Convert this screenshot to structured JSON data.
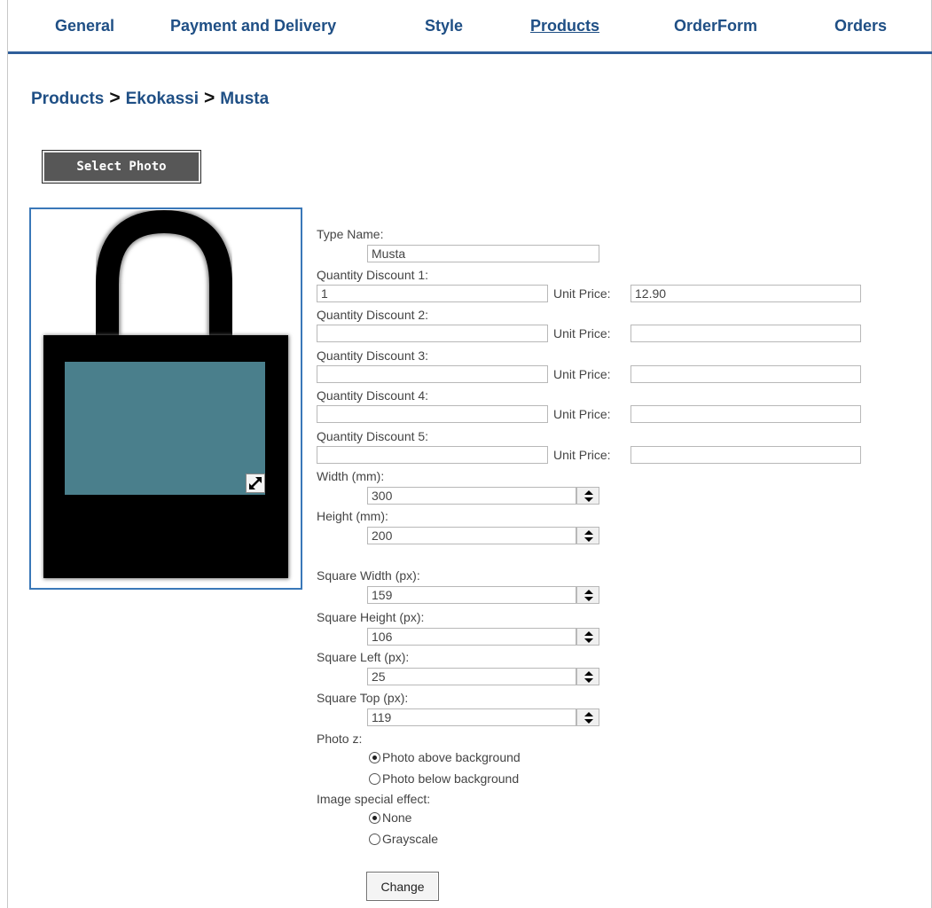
{
  "nav": {
    "items": [
      {
        "label": "General"
      },
      {
        "label": "Payment and Delivery"
      },
      {
        "label": "Style"
      },
      {
        "label": "Products"
      },
      {
        "label": "OrderForm"
      },
      {
        "label": "Orders"
      }
    ],
    "active": "Products"
  },
  "breadcrumb": {
    "items": [
      "Products",
      "Ekokassi",
      "Musta"
    ],
    "separator": ">"
  },
  "select_photo_label": "Select Photo",
  "preview": {
    "bag_color": "#000000",
    "square_color": "#4a7f8c",
    "icons": [
      "resize-icon"
    ]
  },
  "form": {
    "type_name_label": "Type Name:",
    "type_name_value": "Musta",
    "unit_price_label": "Unit Price:",
    "discounts": [
      {
        "label": "Quantity Discount 1:",
        "quantity": "1",
        "price": "12.90"
      },
      {
        "label": "Quantity Discount 2:",
        "quantity": "",
        "price": ""
      },
      {
        "label": "Quantity Discount 3:",
        "quantity": "",
        "price": ""
      },
      {
        "label": "Quantity Discount 4:",
        "quantity": "",
        "price": ""
      },
      {
        "label": "Quantity Discount 5:",
        "quantity": "",
        "price": ""
      }
    ],
    "width_label": "Width (mm):",
    "width_value": "300",
    "height_label": "Height (mm):",
    "height_value": "200",
    "square_width_label": "Square Width (px):",
    "square_width_value": "159",
    "square_height_label": "Square Height (px):",
    "square_height_value": "106",
    "square_left_label": "Square Left (px):",
    "square_left_value": "25",
    "square_top_label": "Square Top (px):",
    "square_top_value": "119",
    "photo_z_label": "Photo z:",
    "photo_z_options": [
      "Photo above background",
      "Photo below background"
    ],
    "photo_z_selected": "Photo above background",
    "effect_label": "Image special effect:",
    "effect_options": [
      "None",
      "Grayscale"
    ],
    "effect_selected": "None",
    "change_label": "Change"
  }
}
